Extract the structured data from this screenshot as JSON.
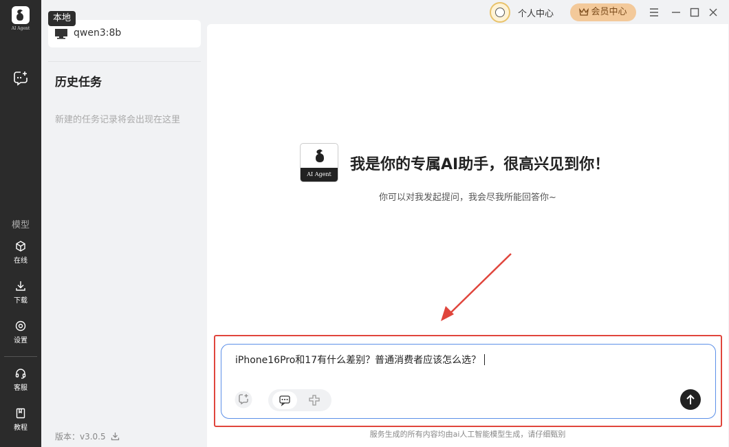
{
  "app": {
    "logo_text": "AI Agent"
  },
  "rail": {
    "section_label": "模型",
    "items": [
      {
        "label": "在线",
        "icon": "cube-icon"
      },
      {
        "label": "下载",
        "icon": "download-icon"
      },
      {
        "label": "设置",
        "icon": "gear-icon"
      },
      {
        "label": "客服",
        "icon": "headset-icon"
      },
      {
        "label": "教程",
        "icon": "book-icon"
      }
    ]
  },
  "history": {
    "badge": "本地",
    "model_name": "qwen3:8b",
    "title": "历史任务",
    "empty_text": "新建的任务记录将会出现在这里",
    "version": "版本：v3.0.5"
  },
  "titlebar": {
    "personal_center": "个人中心",
    "vip_center": "会员中心"
  },
  "welcome": {
    "logo_text": "AI Agent",
    "title": "我是你的专属AI助手，很高兴见到你！",
    "subtitle": "你可以对我发起提问，我会尽我所能回答你~"
  },
  "input": {
    "value": "iPhone16Pro和17有什么差别？普通消费者应该怎么选？"
  },
  "disclaimer": "服务生成的所有内容均由ai人工智能模型生成，请仔细甄别",
  "colors": {
    "rail_bg": "#2b2b2b",
    "accent_border": "#5b8fe8",
    "highlight": "#e0453c",
    "vip_bg": "#f3c99a"
  }
}
